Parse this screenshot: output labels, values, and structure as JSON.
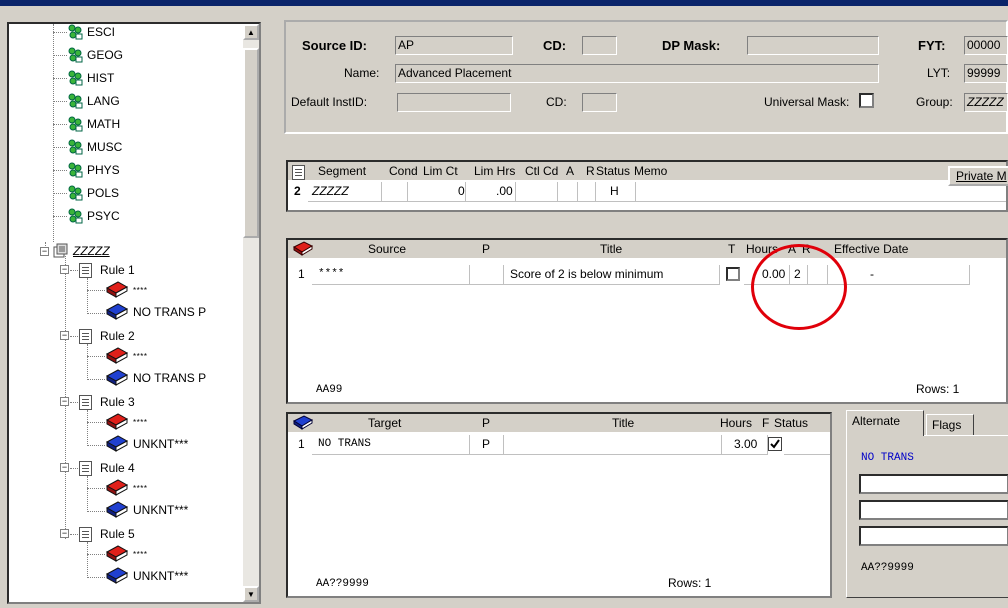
{
  "tree": {
    "subjects": [
      "ESCI",
      "GEOG",
      "HIST",
      "LANG",
      "MATH",
      "MUSC",
      "PHYS",
      "POLS",
      "PSYC"
    ],
    "group_label": "ZZZZZ",
    "rules": [
      {
        "label": "Rule 1",
        "source": "****",
        "target": "NO TRANS P"
      },
      {
        "label": "Rule 2",
        "source": "****",
        "target": "NO TRANS P"
      },
      {
        "label": "Rule 3",
        "source": "****",
        "target": "UNKNT***"
      },
      {
        "label": "Rule 4",
        "source": "****",
        "target": "UNKNT***"
      },
      {
        "label": "Rule 5",
        "source": "****",
        "target": "UNKNT***"
      }
    ]
  },
  "header": {
    "source_id_label": "Source ID:",
    "source_id_value": "AP",
    "cd_label": "CD:",
    "cd_value": "",
    "dp_mask_label": "DP Mask:",
    "dp_mask_value": "",
    "fyt_label": "FYT:",
    "fyt_value": "00000",
    "name_label": "Name:",
    "name_value": "Advanced Placement",
    "lyt_label": "LYT:",
    "lyt_value": "99999",
    "default_instid_label": "Default InstID:",
    "default_instid_value": "",
    "cd2_label": "CD:",
    "cd2_value": "",
    "universal_mask_label": "Universal Mask:",
    "group_label": "Group:",
    "group_value": "ZZZZZ"
  },
  "segment": {
    "headers": [
      "Segment",
      "Cond",
      "Lim Ct",
      "Lim Hrs",
      "Ctl Cd",
      "A",
      "R",
      "Status",
      "Memo"
    ],
    "row": {
      "num": "2",
      "segment": "ZZZZZ",
      "cond": "",
      "lim_ct": "0",
      "lim_hrs": ".00",
      "ctl_cd": "",
      "a": "",
      "r": "",
      "status": "H",
      "memo": ""
    },
    "private_button": "Private M"
  },
  "source_grid": {
    "headers": [
      "Source",
      "P",
      "Title",
      "T",
      "Hours",
      "A",
      "R",
      "Effective Date"
    ],
    "rows": [
      {
        "num": "1",
        "source": "****",
        "p": "",
        "title": "Score of 2 is below minimum",
        "hours": "0.00",
        "a": "2",
        "r": "",
        "eff_date": "-"
      }
    ],
    "footer_code": "AA99",
    "rows_label": "Rows: 1"
  },
  "target_grid": {
    "headers": [
      "Target",
      "P",
      "Title",
      "Hours",
      "F",
      "Status"
    ],
    "rows": [
      {
        "num": "1",
        "target": "NO TRANS",
        "p": "P",
        "title": "",
        "hours": "3.00",
        "status": ""
      }
    ],
    "footer_code": "AA??9999",
    "rows_label": "Rows: 1"
  },
  "alt_panel": {
    "tabs": [
      "Alternate",
      "Flags"
    ],
    "value": "NO TRANS",
    "footer_code": "AA??9999"
  },
  "colors": {
    "title_bar": "#0a246a",
    "highlight_circle": "#e0000a",
    "alt_text": "#0000c8"
  }
}
